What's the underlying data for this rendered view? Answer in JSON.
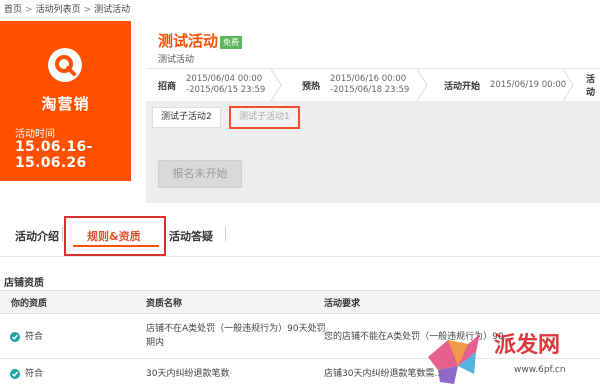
{
  "breadcrumb": [
    "首页",
    "活动列表页",
    "测试活动"
  ],
  "card": {
    "brand": "淘营销",
    "time_label": "活动时间",
    "time_value": "15.06.16-15.06.26",
    "bg_color": "#ff5000"
  },
  "header": {
    "title": "测试活动",
    "badge": "免费",
    "subtitle": "测试活动"
  },
  "timeline": [
    {
      "name": "招商",
      "start": "2015/06/04 00:00",
      "end": "-2015/06/15 23:59"
    },
    {
      "name": "预热",
      "start": "2015/06/16 00:00",
      "end": "-2015/06/18 23:59"
    },
    {
      "name": "活动开始",
      "date": "2015/06/19 00:00"
    },
    {
      "name": "活动"
    }
  ],
  "subtabs": [
    "测试子活动2",
    "测试子活动1"
  ],
  "signup_button": "报名未开始",
  "main_tabs": [
    "活动介绍",
    "规则&资质",
    "活动答疑"
  ],
  "section_title": "店铺资质",
  "table": {
    "headers": [
      "你的资质",
      "资质名称",
      "活动要求"
    ],
    "rows": [
      {
        "status": "符合",
        "name_line1": "店铺不在A类处罚（一般违规行为）90天处罚",
        "name_line2": "期内",
        "req": "您的店铺不能在A类处罚（一般违规行为）90..."
      },
      {
        "status": "符合",
        "name_line1": "30天内纠纷退款笔数",
        "name_line2": "",
        "req": "店铺30天内纠纷退款笔数需..."
      }
    ]
  },
  "watermark": {
    "text": "派发网",
    "url": "www.6pf.cn"
  },
  "colors": {
    "accent": "#ff5000",
    "highlight": "#d9322f",
    "check": "#1aa3a0",
    "badge": "#5cb85c"
  }
}
